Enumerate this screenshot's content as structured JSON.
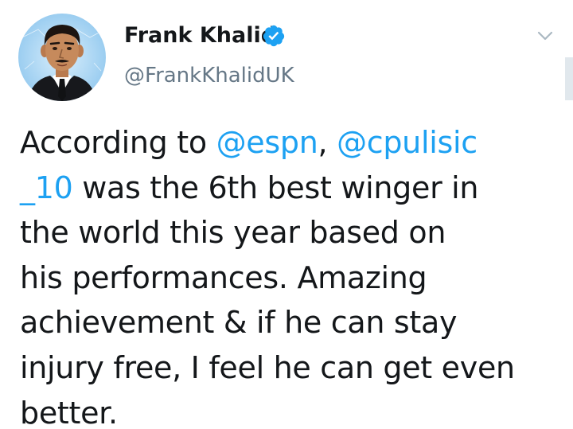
{
  "tweet": {
    "author": {
      "display_name": "Frank Khalid",
      "handle": "@FrankKhalidUK",
      "verified": true,
      "avatar_icon": "cartoon-man-avatar-icon"
    },
    "menu_icon": "chevron-down-icon",
    "text_lines": [
      {
        "parts": [
          {
            "text": "According to ",
            "type": "text"
          },
          {
            "text": "@espn",
            "type": "mention"
          },
          {
            "text": ", ",
            "type": "text"
          },
          {
            "text": "@cpulisic",
            "type": "mention"
          }
        ]
      },
      {
        "parts": [
          {
            "text": "_10",
            "type": "mention"
          },
          {
            "text": " was the 6th best winger in",
            "type": "text"
          }
        ]
      },
      {
        "parts": [
          {
            "text": "the world this year based on",
            "type": "text"
          }
        ]
      },
      {
        "parts": [
          {
            "text": "his performances. Amazing",
            "type": "text"
          }
        ]
      },
      {
        "parts": [
          {
            "text": "achievement & if he can stay",
            "type": "text"
          }
        ]
      },
      {
        "parts": [
          {
            "text": "injury free, I feel he can get even",
            "type": "text"
          }
        ]
      },
      {
        "parts": [
          {
            "text": "better.",
            "type": "text"
          }
        ]
      }
    ]
  },
  "colors": {
    "link": "#1da1f2",
    "verified": "#1da1f2",
    "secondary_text": "#657786",
    "primary_text": "#14171a",
    "caret": "#aab8c2"
  }
}
